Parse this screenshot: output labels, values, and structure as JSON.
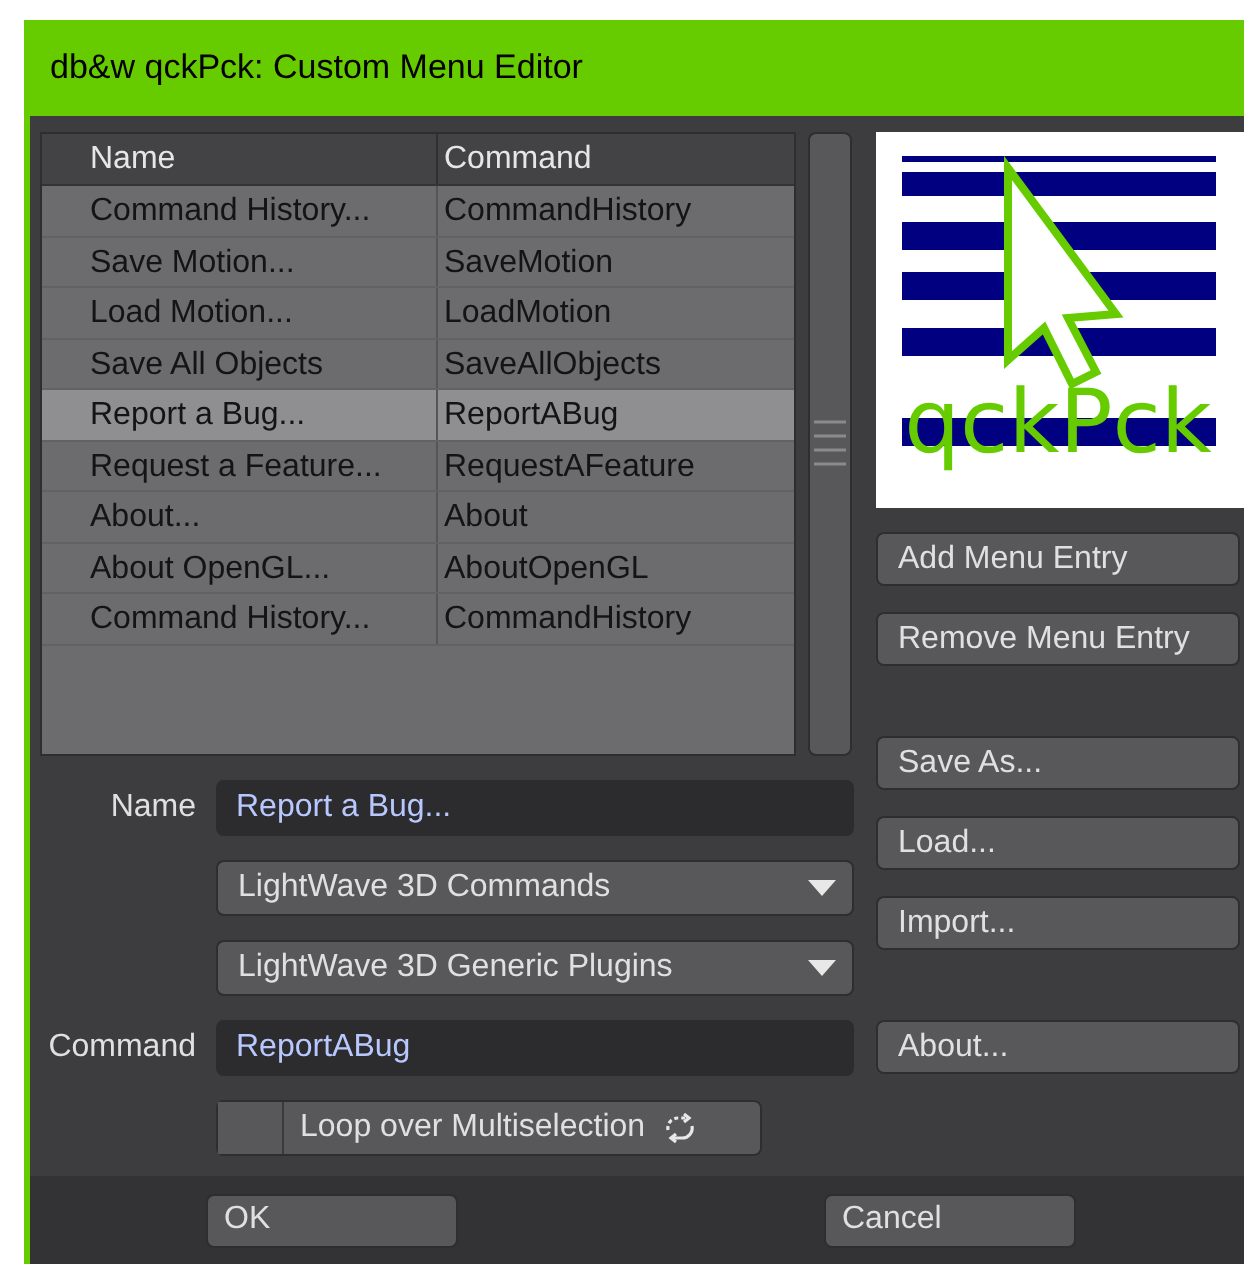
{
  "window": {
    "title": "db&w qckPck: Custom Menu Editor"
  },
  "table": {
    "columns": [
      "Name",
      "Command"
    ],
    "rows": [
      {
        "name": "Command History...",
        "command": "CommandHistory",
        "selected": false
      },
      {
        "name": "Save Motion...",
        "command": "SaveMotion",
        "selected": false
      },
      {
        "name": "Load Motion...",
        "command": "LoadMotion",
        "selected": false
      },
      {
        "name": "Save All Objects",
        "command": "SaveAllObjects",
        "selected": false
      },
      {
        "name": "Report a Bug...",
        "command": "ReportABug",
        "selected": true
      },
      {
        "name": "Request a Feature...",
        "command": "RequestAFeature",
        "selected": false
      },
      {
        "name": "About...",
        "command": "About",
        "selected": false
      },
      {
        "name": "About OpenGL...",
        "command": "AboutOpenGL",
        "selected": false
      },
      {
        "name": "Command History...",
        "command": "CommandHistory",
        "selected": false
      }
    ]
  },
  "logo": {
    "text": "qckPck"
  },
  "side_button_groups": [
    [
      "Add Menu Entry",
      "Remove Menu Entry"
    ],
    [
      "Save As...",
      "Load...",
      "Import..."
    ],
    [
      "About..."
    ]
  ],
  "form": [
    {
      "kind": "field",
      "label": "Name",
      "value": "Report a Bug..."
    },
    {
      "kind": "dropdown",
      "value": "LightWave 3D Commands"
    },
    {
      "kind": "dropdown",
      "value": "LightWave 3D Generic Plugins"
    },
    {
      "kind": "field",
      "label": "Command",
      "value": "ReportABug"
    },
    {
      "kind": "checkbox",
      "label": "Loop over Multiselection",
      "checked": false
    }
  ],
  "footer_buttons": [
    "OK",
    "Cancel"
  ]
}
